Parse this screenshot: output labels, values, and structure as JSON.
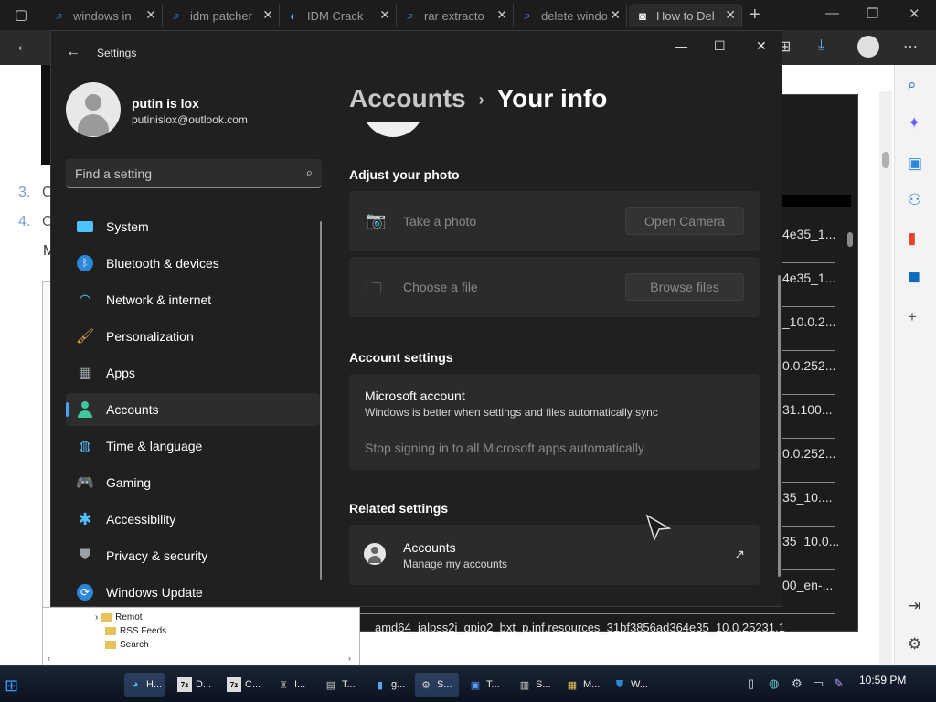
{
  "browser": {
    "tabs": [
      {
        "label": "windows in",
        "icon": "search-icon"
      },
      {
        "label": "idm patcher",
        "icon": "search-icon"
      },
      {
        "label": "IDM Crack",
        "icon": "idm-site-icon"
      },
      {
        "label": "rar extracto",
        "icon": "search-icon"
      },
      {
        "label": "delete windo",
        "icon": "search-icon"
      },
      {
        "label": "How to Del",
        "icon": "site-icon",
        "active": true
      }
    ],
    "page_list": [
      "3.",
      "4."
    ],
    "page_letters": [
      "C",
      "C"
    ],
    "page_m": "M"
  },
  "explorer": {
    "rows": [
      "4e35_1...",
      "4e35_1...",
      "_10.0.2...",
      "0.0.252...",
      "31.100...",
      "0.0.252...",
      "35_10....",
      "35_10.0...",
      "00_en-..."
    ],
    "bottom_row": "amd64_ialpss2i_gpio2_bxt_p.inf.resources_31bf3856ad364e35_10.0.25231.1",
    "tree": [
      "Remot",
      "RSS Feeds",
      "Search"
    ]
  },
  "settings": {
    "title": "Settings",
    "profile": {
      "name": "putin is lox",
      "email": "putinislox@outlook.com"
    },
    "search_placeholder": "Find a setting",
    "nav": [
      {
        "label": "System",
        "icon": "system-icon",
        "color": "#4cc2ff"
      },
      {
        "label": "Bluetooth & devices",
        "icon": "bluetooth-icon",
        "color": "#2b88d8"
      },
      {
        "label": "Network & internet",
        "icon": "wifi-icon",
        "color": "#4cc2ff"
      },
      {
        "label": "Personalization",
        "icon": "paintbrush-icon",
        "color": "#e8a04a"
      },
      {
        "label": "Apps",
        "icon": "apps-icon",
        "color": "#9aa0a6"
      },
      {
        "label": "Accounts",
        "icon": "accounts-icon",
        "color": "#3fc7a0",
        "selected": true
      },
      {
        "label": "Time & language",
        "icon": "globe-clock-icon",
        "color": "#4cc2ff"
      },
      {
        "label": "Gaming",
        "icon": "gamepad-icon",
        "color": "#c8c8c8"
      },
      {
        "label": "Accessibility",
        "icon": "accessibility-icon",
        "color": "#4cc2ff"
      },
      {
        "label": "Privacy & security",
        "icon": "shield-icon",
        "color": "#9aa0a6"
      },
      {
        "label": "Windows Update",
        "icon": "update-icon",
        "color": "#4cc2ff"
      }
    ],
    "breadcrumb": {
      "parent": "Accounts",
      "separator": "›",
      "current": "Your info"
    },
    "adjust_photo": {
      "heading": "Adjust your photo",
      "take_photo": {
        "label": "Take a photo",
        "button": "Open Camera"
      },
      "choose_file": {
        "label": "Choose a file",
        "button": "Browse files"
      }
    },
    "account_settings": {
      "heading": "Account settings",
      "ms_title": "Microsoft account",
      "ms_sub": "Windows is better when settings and files automatically sync",
      "ms_link": "Stop signing in to all Microsoft apps automatically"
    },
    "related": {
      "heading": "Related settings",
      "title": "Accounts",
      "sub": "Manage my accounts"
    }
  },
  "taskbar": {
    "items": [
      {
        "label": "H...",
        "icon": "edge-icon",
        "active": true
      },
      {
        "label": "D...",
        "icon": "7zip-icon"
      },
      {
        "label": "C...",
        "icon": "7zip-icon"
      },
      {
        "label": "I...",
        "icon": "app-icon"
      },
      {
        "label": "T...",
        "icon": "window-icon"
      },
      {
        "label": "g...",
        "icon": "file-icon"
      },
      {
        "label": "S...",
        "icon": "settings-icon",
        "active": true
      },
      {
        "label": "T...",
        "icon": "terminal-icon"
      },
      {
        "label": "S...",
        "icon": "doc-icon"
      },
      {
        "label": "M...",
        "icon": "apps-icon"
      },
      {
        "label": "W...",
        "icon": "defender-icon"
      }
    ],
    "clock": "10:59 PM"
  }
}
